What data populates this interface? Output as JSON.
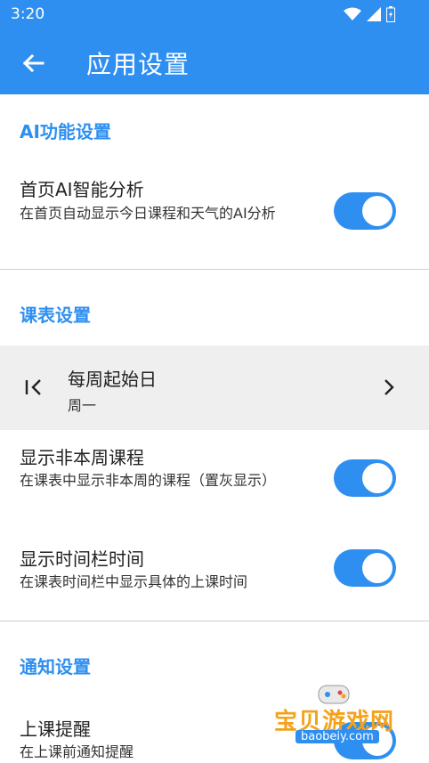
{
  "status_bar": {
    "time": "3:20"
  },
  "app_bar": {
    "title": "应用设置"
  },
  "sections": [
    {
      "header": "AI功能设置",
      "items": [
        {
          "title": "首页AI智能分析",
          "subtitle": "在首页自动显示今日课程和天气的AI分析",
          "enabled": true
        }
      ]
    },
    {
      "header": "课表设置",
      "week_start": {
        "title": "每周起始日",
        "value": "周一"
      },
      "items": [
        {
          "title": "显示非本周课程",
          "subtitle": "在课表中显示非本周的课程（置灰显示）",
          "enabled": true
        },
        {
          "title": "显示时间栏时间",
          "subtitle": "在课表时间栏中显示具体的上课时间",
          "enabled": true
        }
      ]
    },
    {
      "header": "通知设置",
      "items": [
        {
          "title": "上课提醒",
          "subtitle": "在上课前通知提醒",
          "enabled": true
        }
      ]
    }
  ],
  "watermark": {
    "text": "宝贝游戏网",
    "url": "baobeiy.com"
  },
  "colors": {
    "accent": "#2e8ff0",
    "row_highlight": "#efefef",
    "divider": "#cfcfcf"
  },
  "icons": {
    "back": "arrow-left-icon",
    "week_start": "first-page-icon",
    "chevron": "chevron-right-icon",
    "wifi": "wifi-icon",
    "signal": "signal-icon",
    "battery": "battery-icon"
  }
}
